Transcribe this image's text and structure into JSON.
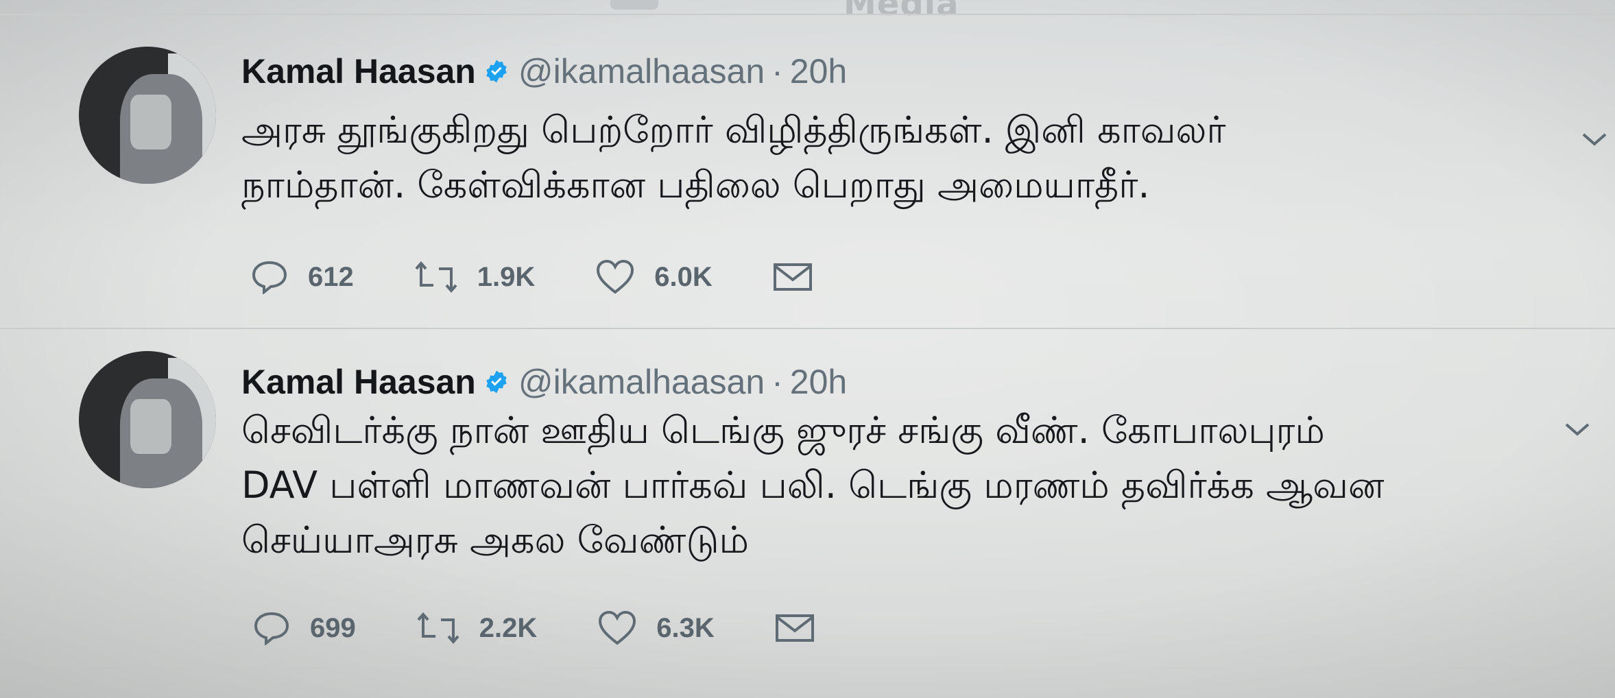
{
  "header": {
    "title": "Media"
  },
  "tweets": [
    {
      "name": "Kamal Haasan",
      "handle": "@ikamalhaasan",
      "separator": "·",
      "time": "20h",
      "text": "அரசு தூங்குகிறது பெற்றோர் விழித்திருங்கள். இனி காவலர்\nநாம்தான். கேள்விக்கான பதிலை பெறாது அமையாதீர்.",
      "replies": "612",
      "retweets": "1.9K",
      "likes": "6.0K"
    },
    {
      "name": "Kamal Haasan",
      "handle": "@ikamalhaasan",
      "separator": "·",
      "time": "20h",
      "text": "செவிடர்க்கு நான் ஊதிய டெங்கு ஜுரச் சங்கு வீண். கோபாலபுரம்\nDAV பள்ளி மாணவன் பார்கவ் பலி. டெங்கு மரணம் தவிர்க்க ஆவன\nசெய்யாஅரசு அகல வேண்டும்",
      "replies": "699",
      "retweets": "2.2K",
      "likes": "6.3K"
    }
  ],
  "icons": {
    "reply": "reply-icon",
    "retweet": "retweet-icon",
    "like": "heart-icon",
    "dm": "envelope-icon",
    "verified": "verified-badge-icon",
    "more": "chevron-down-icon"
  },
  "colors": {
    "verified": "#1da1f2",
    "icon": "#5f6b74",
    "name": "#14171a",
    "meta": "#64707a"
  }
}
